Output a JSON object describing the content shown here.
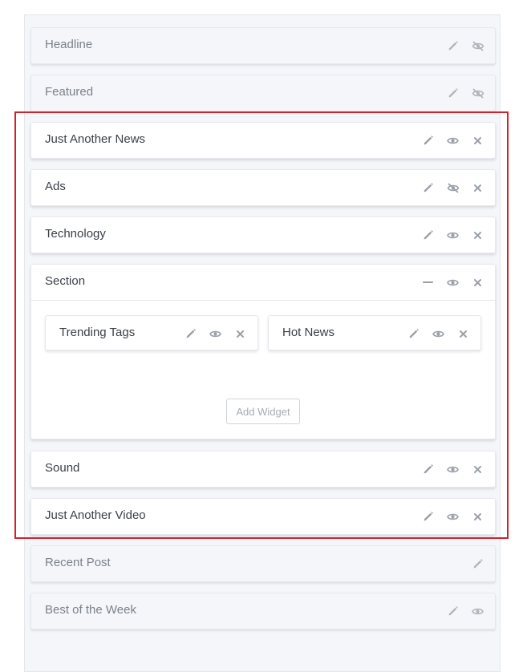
{
  "colors": {
    "highlight": "#d1232a",
    "icon": "#9aa0a8",
    "text_active": "#3a3f47",
    "text_inactive": "#7b818b"
  },
  "widgets": [
    {
      "title": "Headline",
      "icons": [
        "pencil-icon",
        "eye-off-icon"
      ]
    },
    {
      "title": "Featured",
      "icons": [
        "pencil-icon",
        "eye-off-icon"
      ]
    },
    {
      "title": "Just Another News",
      "icons": [
        "pencil-icon",
        "eye-icon",
        "close-icon"
      ]
    },
    {
      "title": "Ads",
      "icons": [
        "pencil-icon",
        "eye-off-icon",
        "close-icon"
      ]
    },
    {
      "title": "Technology",
      "icons": [
        "pencil-icon",
        "eye-icon",
        "close-icon"
      ]
    },
    {
      "title": "Section",
      "icons": [
        "minus-icon",
        "eye-icon",
        "close-icon"
      ],
      "children": [
        {
          "title": "Trending Tags",
          "icons": [
            "pencil-icon",
            "eye-icon",
            "close-icon"
          ]
        },
        {
          "title": "Hot News",
          "icons": [
            "pencil-icon",
            "eye-icon",
            "close-icon"
          ]
        }
      ],
      "add_widget_label": "Add Widget"
    },
    {
      "title": "Sound",
      "icons": [
        "pencil-icon",
        "eye-icon",
        "close-icon"
      ]
    },
    {
      "title": "Just Another Video",
      "icons": [
        "pencil-icon",
        "eye-icon",
        "close-icon"
      ]
    },
    {
      "title": "Recent Post",
      "icons": [
        "pencil-icon"
      ]
    },
    {
      "title": "Best of the Week",
      "icons": [
        "pencil-icon",
        "eye-icon"
      ]
    }
  ]
}
